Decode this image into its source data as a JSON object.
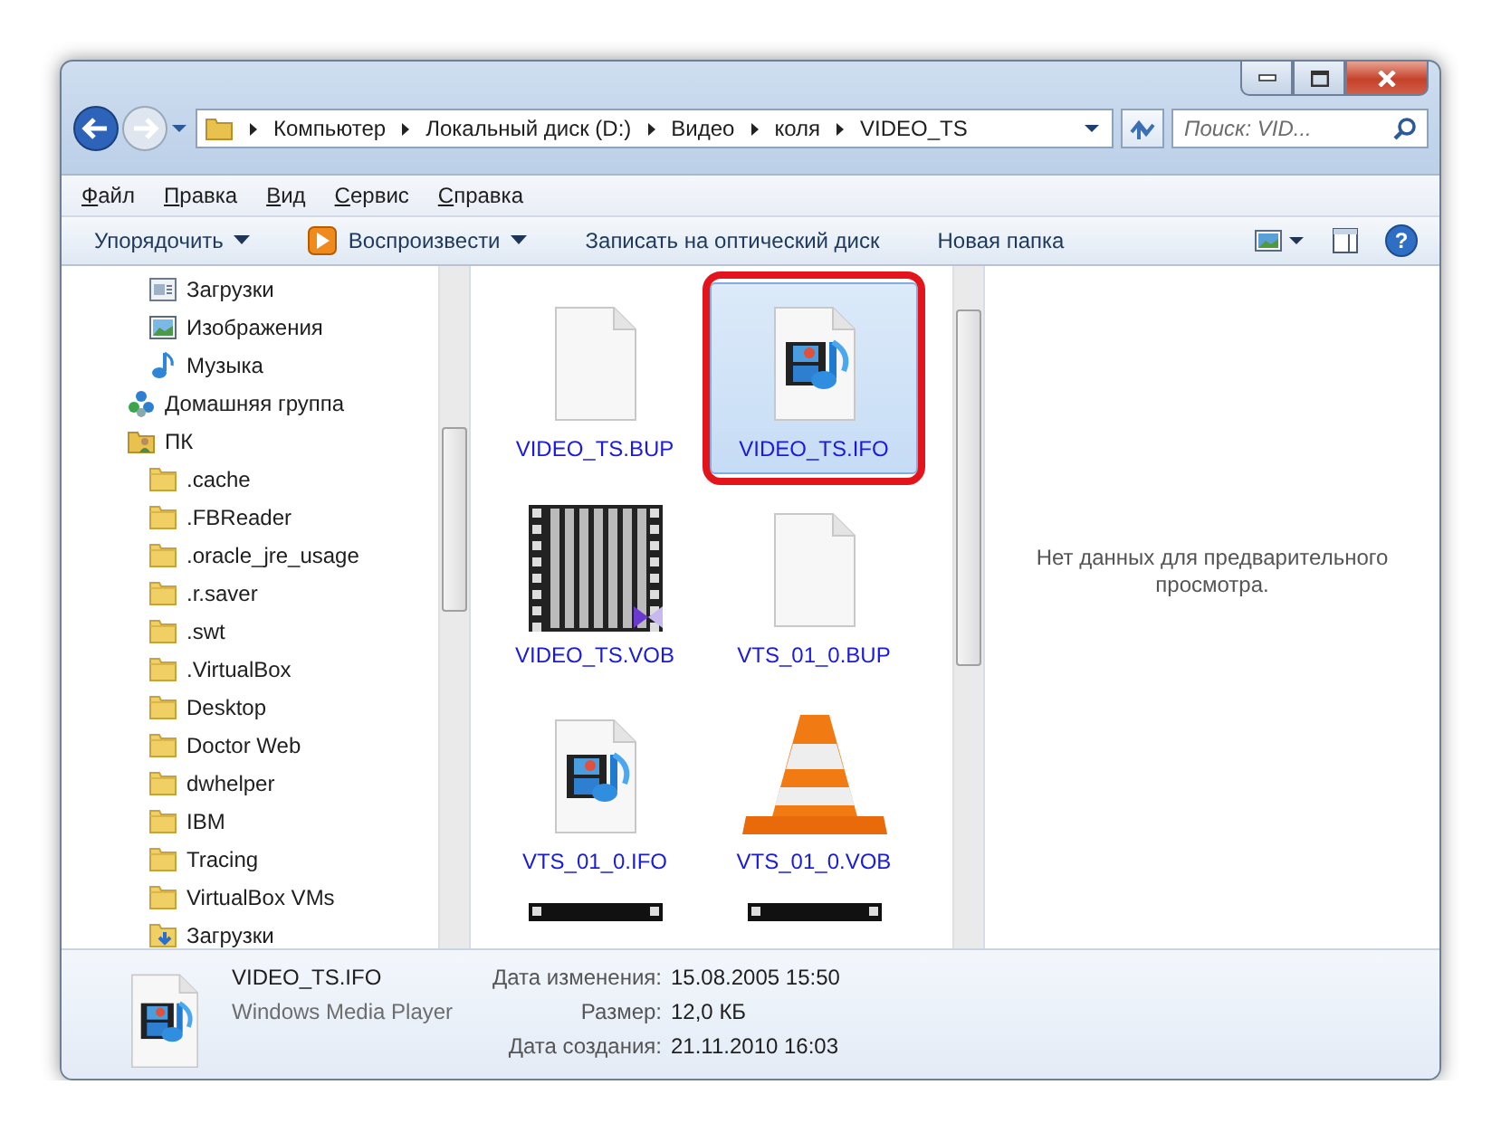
{
  "help": {
    "label": "?"
  },
  "address_bar": {
    "crumbs": [
      "Компьютер",
      "Локальный диск (D:)",
      "Видео",
      "коля",
      "VIDEO_TS"
    ]
  },
  "search": {
    "placeholder": "Поиск: VID..."
  },
  "menu": [
    "Файл",
    "Правка",
    "Вид",
    "Сервис",
    "Справка"
  ],
  "toolbar": [
    {
      "label": "Упорядочить",
      "kind": "dropdown"
    },
    {
      "label": "Воспроизвести",
      "kind": "play"
    },
    {
      "label": "Записать на оптический диск",
      "kind": "plain"
    },
    {
      "label": "Новая папка",
      "kind": "plain"
    }
  ],
  "tree": [
    {
      "children": [
        {
          "label": "Загрузки",
          "kind": "downloads"
        },
        {
          "label": "Изображения",
          "kind": "pictures"
        },
        {
          "label": "Музыка",
          "kind": "music"
        }
      ]
    },
    {
      "label": "Домашняя группа",
      "kind": "homegroup"
    },
    {
      "label": "ПК",
      "kind": "computer",
      "children": [
        {
          "label": ".cache",
          "kind": "folder"
        },
        {
          "label": ".FBReader",
          "kind": "folder"
        },
        {
          "label": ".oracle_jre_usage",
          "kind": "folder"
        },
        {
          "label": ".r.saver",
          "kind": "folder"
        },
        {
          "label": ".swt",
          "kind": "folder"
        },
        {
          "label": ".VirtualBox",
          "kind": "folder"
        },
        {
          "label": "Desktop",
          "kind": "folder"
        },
        {
          "label": "Doctor Web",
          "kind": "folder"
        },
        {
          "label": "dwhelper",
          "kind": "folder"
        },
        {
          "label": "IBM",
          "kind": "folder"
        },
        {
          "label": "Tracing",
          "kind": "folder"
        },
        {
          "label": "VirtualBox VMs",
          "kind": "folder"
        },
        {
          "label": "Загрузки",
          "kind": "folder-download"
        }
      ]
    }
  ],
  "files": [
    {
      "name": "VIDEO_TS.BUP",
      "kind": "blank",
      "selected": false,
      "highlighted": false
    },
    {
      "name": "VIDEO_TS.IFO",
      "kind": "media",
      "selected": true,
      "highlighted": true
    },
    {
      "name": "VIDEO_TS.VOB",
      "kind": "video",
      "selected": false,
      "highlighted": false
    },
    {
      "name": "VTS_01_0.BUP",
      "kind": "blank",
      "selected": false,
      "highlighted": false
    },
    {
      "name": "VTS_01_0.IFO",
      "kind": "media",
      "selected": false,
      "highlighted": false
    },
    {
      "name": "VTS_01_0.VOB",
      "kind": "cone",
      "selected": false,
      "highlighted": false
    },
    {
      "kind": "video-cut",
      "selected": false,
      "highlighted": false
    },
    {
      "kind": "video-cut",
      "selected": false,
      "highlighted": false
    }
  ],
  "preview": {
    "message": "Нет данных для предварительного просмотра."
  },
  "details": {
    "name": "VIDEO_TS.IFO",
    "type": "Windows Media Player",
    "properties": [
      {
        "label": "Дата изменения:",
        "value": "15.08.2005 15:50"
      },
      {
        "label": "Размер:",
        "value": "12,0 КБ"
      },
      {
        "label": "Дата создания:",
        "value": "21.11.2010 16:03"
      }
    ]
  }
}
